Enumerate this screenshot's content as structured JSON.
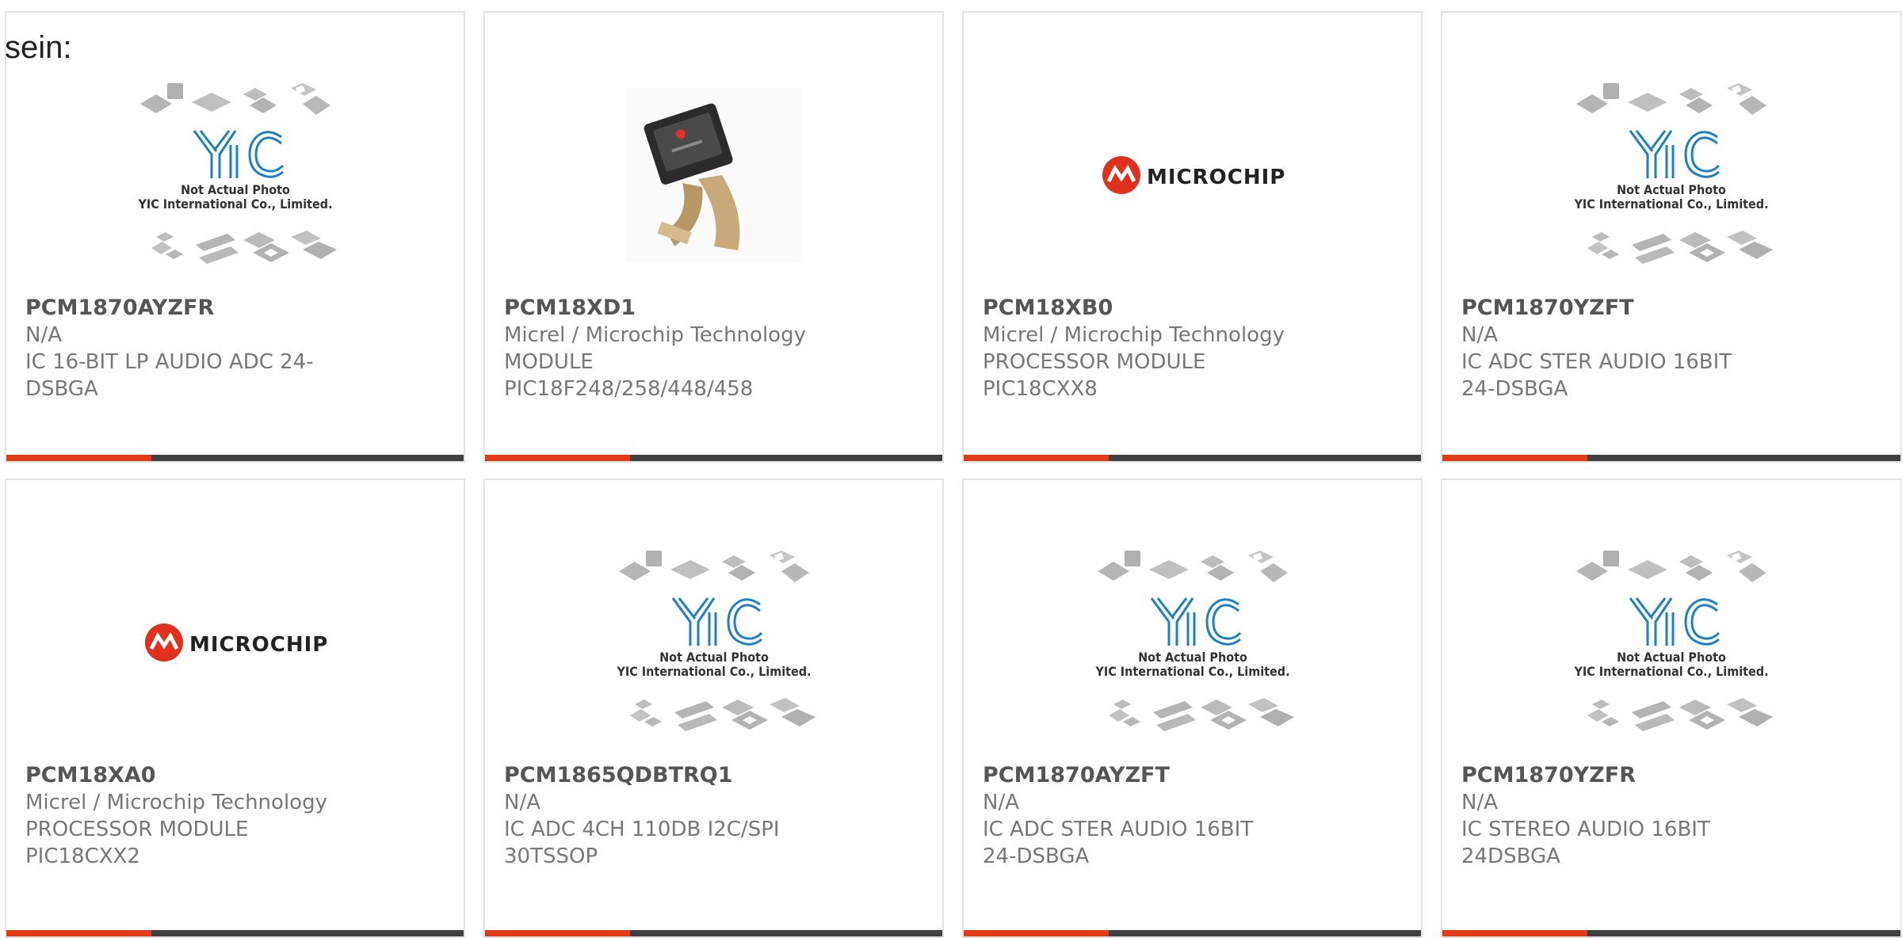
{
  "page": {
    "label": "sein:"
  },
  "placeholder_image": {
    "line1": "Not Actual Photo",
    "line2": "YIC International Co., Limited."
  },
  "microchip_logo": {
    "word": "MICROCHIP"
  },
  "colors": {
    "accent": "#e23c17",
    "bar": "#404040",
    "yic_blue": "#1d7fc4",
    "microchip_red": "#e0301e"
  },
  "products": [
    {
      "part_number": "PCM1870AYZFR",
      "manufacturer": "N/A",
      "description": "IC 16-BIT LP AUDIO ADC 24-DSBGA",
      "image": "yic-placeholder"
    },
    {
      "part_number": "PCM18XD1",
      "manufacturer": "Micrel / Microchip Technology",
      "description": "MODULE PIC18F248/258/448/458",
      "image": "product-photo"
    },
    {
      "part_number": "PCM18XB0",
      "manufacturer": "Micrel / Microchip Technology",
      "description": "PROCESSOR MODULE PIC18CXX8",
      "image": "microchip-logo"
    },
    {
      "part_number": "PCM1870YZFT",
      "manufacturer": "N/A",
      "description": "IC ADC STER AUDIO 16BIT 24-DSBGA",
      "image": "yic-placeholder"
    },
    {
      "part_number": "PCM18XA0",
      "manufacturer": "Micrel / Microchip Technology",
      "description": "PROCESSOR MODULE PIC18CXX2",
      "image": "microchip-logo"
    },
    {
      "part_number": "PCM1865QDBTRQ1",
      "manufacturer": "N/A",
      "description": "IC ADC 4CH 110DB I2C/SPI 30TSSOP",
      "image": "yic-placeholder"
    },
    {
      "part_number": "PCM1870AYZFT",
      "manufacturer": "N/A",
      "description": "IC ADC STER AUDIO 16BIT 24-DSBGA",
      "image": "yic-placeholder"
    },
    {
      "part_number": "PCM1870YZFR",
      "manufacturer": "N/A",
      "description": "IC STEREO AUDIO 16BIT 24DSBGA",
      "image": "yic-placeholder"
    }
  ]
}
